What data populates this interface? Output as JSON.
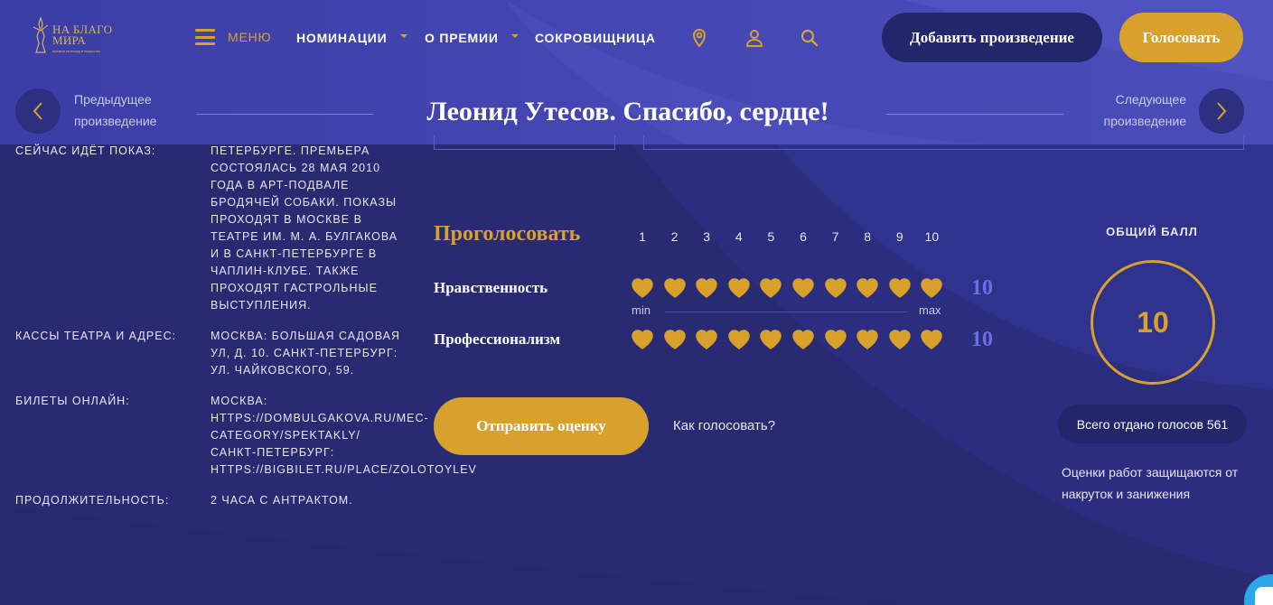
{
  "header": {
    "logo_text_line1": "НА БЛАГО",
    "logo_text_line2": "МИРА",
    "logo_subtitle": "премия за вклад в искусство",
    "menu_label": "МЕНЮ",
    "nav": [
      {
        "label": "НОМИНАЦИИ",
        "has_dropdown": true
      },
      {
        "label": "О ПРЕМИИ",
        "has_dropdown": true
      },
      {
        "label": "СОКРОВИЩНИЦА",
        "has_dropdown": false
      }
    ],
    "icons": [
      "location-pin-icon",
      "user-icon",
      "search-icon"
    ],
    "add_work_button": "Добавить произведение",
    "vote_button": "Голосовать"
  },
  "work_nav": {
    "prev_line1": "Предыдущее",
    "prev_line2": "произведение",
    "next_line1": "Следующее",
    "next_line2": "произведение",
    "title": "Леонид Утесов. Спасибо, сердце!"
  },
  "info": [
    {
      "label": "СЕЙЧАС ИДЁТ ПОКАЗ:",
      "value_lines": [
        "ПЕТЕРБУРГЕ. ПРЕМЬЕРА",
        "СОСТОЯЛАСЬ 28 МАЯ 2010",
        "ГОДА В АРТ-ПОДВАЛЕ",
        "БРОДЯЧЕЙ СОБАКИ. ПОКАЗЫ",
        "ПРОХОДЯТ В МОСКВЕ В",
        "ТЕАТРЕ ИМ. М. А. БУЛГАКОВА",
        "И В САНКТ-ПЕТЕРБУРГЕ В",
        "ЧАПЛИН-КЛУБЕ. ТАКЖЕ",
        "ПРОХОДЯТ ГАСТРОЛЬНЫЕ",
        "ВЫСТУПЛЕНИЯ."
      ]
    },
    {
      "label": "КАССЫ ТЕАТРА И АДРЕС:",
      "value_lines": [
        "МОСКВА: БОЛЬШАЯ САДОВАЯ",
        "УЛ, Д. 10. САНКТ-ПЕТЕРБУРГ:",
        "УЛ. ЧАЙКОВСКОГО, 59."
      ]
    },
    {
      "label": "БИЛЕТЫ ОНЛАЙН:",
      "value_lines": [
        "МОСКВА:",
        "HTTPS://DOMBULGAKOVA.RU/MEC-",
        "CATEGORY/SPEKTAKLY/",
        "САНКТ-ПЕТЕРБУРГ:",
        "HTTPS://BIGBILET.RU/PLACE/ZOLOTOYLEV"
      ]
    },
    {
      "label": "ПРОДОЛЖИТЕЛЬНОСТЬ:",
      "value_lines": [
        "2 ЧАСА С АНТРАКТОМ."
      ]
    }
  ],
  "voting": {
    "heading": "Проголосовать",
    "scale": [
      "1",
      "2",
      "3",
      "4",
      "5",
      "6",
      "7",
      "8",
      "9",
      "10"
    ],
    "min_label": "min",
    "max_label": "max",
    "criteria": [
      {
        "label": "Нравственность",
        "value": 10,
        "value_text": "10"
      },
      {
        "label": "Профессионализм",
        "value": 10,
        "value_text": "10"
      }
    ],
    "submit_button": "Отправить оценку",
    "how_to_vote": "Как голосовать?"
  },
  "score": {
    "label": "ОБЩИЙ БАЛЛ",
    "value": "10",
    "total_votes": "Всего отдано голосов 561",
    "note": "Оценки работ защищаются от накруток и занижения"
  },
  "colors": {
    "accent_gold": "#d7a12c",
    "header_bg": "#4346b2",
    "page_bg": "#282b72",
    "pill_bg": "#22266a",
    "score_number_blue": "#6a6ee4"
  }
}
